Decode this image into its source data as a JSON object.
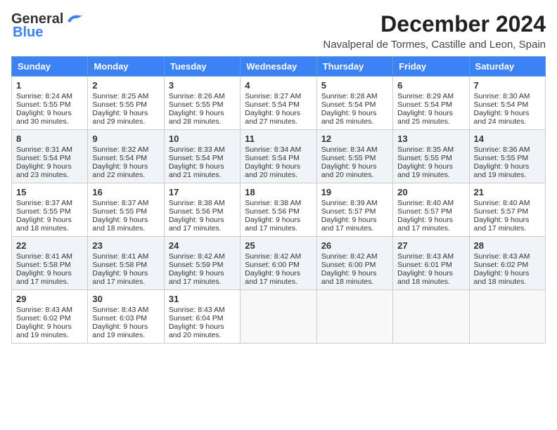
{
  "header": {
    "logo_line1": "General",
    "logo_line2": "Blue",
    "title": "December 2024",
    "subtitle": "Navalperal de Tormes, Castille and Leon, Spain"
  },
  "days_of_week": [
    "Sunday",
    "Monday",
    "Tuesday",
    "Wednesday",
    "Thursday",
    "Friday",
    "Saturday"
  ],
  "weeks": [
    [
      {
        "day": 1,
        "sunrise": "8:24 AM",
        "sunset": "5:55 PM",
        "daylight": "9 hours and 30 minutes."
      },
      {
        "day": 2,
        "sunrise": "8:25 AM",
        "sunset": "5:55 PM",
        "daylight": "9 hours and 29 minutes."
      },
      {
        "day": 3,
        "sunrise": "8:26 AM",
        "sunset": "5:55 PM",
        "daylight": "9 hours and 28 minutes."
      },
      {
        "day": 4,
        "sunrise": "8:27 AM",
        "sunset": "5:54 PM",
        "daylight": "9 hours and 27 minutes."
      },
      {
        "day": 5,
        "sunrise": "8:28 AM",
        "sunset": "5:54 PM",
        "daylight": "9 hours and 26 minutes."
      },
      {
        "day": 6,
        "sunrise": "8:29 AM",
        "sunset": "5:54 PM",
        "daylight": "9 hours and 25 minutes."
      },
      {
        "day": 7,
        "sunrise": "8:30 AM",
        "sunset": "5:54 PM",
        "daylight": "9 hours and 24 minutes."
      }
    ],
    [
      {
        "day": 8,
        "sunrise": "8:31 AM",
        "sunset": "5:54 PM",
        "daylight": "9 hours and 23 minutes."
      },
      {
        "day": 9,
        "sunrise": "8:32 AM",
        "sunset": "5:54 PM",
        "daylight": "9 hours and 22 minutes."
      },
      {
        "day": 10,
        "sunrise": "8:33 AM",
        "sunset": "5:54 PM",
        "daylight": "9 hours and 21 minutes."
      },
      {
        "day": 11,
        "sunrise": "8:34 AM",
        "sunset": "5:54 PM",
        "daylight": "9 hours and 20 minutes."
      },
      {
        "day": 12,
        "sunrise": "8:34 AM",
        "sunset": "5:55 PM",
        "daylight": "9 hours and 20 minutes."
      },
      {
        "day": 13,
        "sunrise": "8:35 AM",
        "sunset": "5:55 PM",
        "daylight": "9 hours and 19 minutes."
      },
      {
        "day": 14,
        "sunrise": "8:36 AM",
        "sunset": "5:55 PM",
        "daylight": "9 hours and 19 minutes."
      }
    ],
    [
      {
        "day": 15,
        "sunrise": "8:37 AM",
        "sunset": "5:55 PM",
        "daylight": "9 hours and 18 minutes."
      },
      {
        "day": 16,
        "sunrise": "8:37 AM",
        "sunset": "5:55 PM",
        "daylight": "9 hours and 18 minutes."
      },
      {
        "day": 17,
        "sunrise": "8:38 AM",
        "sunset": "5:56 PM",
        "daylight": "9 hours and 17 minutes."
      },
      {
        "day": 18,
        "sunrise": "8:38 AM",
        "sunset": "5:56 PM",
        "daylight": "9 hours and 17 minutes."
      },
      {
        "day": 19,
        "sunrise": "8:39 AM",
        "sunset": "5:57 PM",
        "daylight": "9 hours and 17 minutes."
      },
      {
        "day": 20,
        "sunrise": "8:40 AM",
        "sunset": "5:57 PM",
        "daylight": "9 hours and 17 minutes."
      },
      {
        "day": 21,
        "sunrise": "8:40 AM",
        "sunset": "5:57 PM",
        "daylight": "9 hours and 17 minutes."
      }
    ],
    [
      {
        "day": 22,
        "sunrise": "8:41 AM",
        "sunset": "5:58 PM",
        "daylight": "9 hours and 17 minutes."
      },
      {
        "day": 23,
        "sunrise": "8:41 AM",
        "sunset": "5:58 PM",
        "daylight": "9 hours and 17 minutes."
      },
      {
        "day": 24,
        "sunrise": "8:42 AM",
        "sunset": "5:59 PM",
        "daylight": "9 hours and 17 minutes."
      },
      {
        "day": 25,
        "sunrise": "8:42 AM",
        "sunset": "6:00 PM",
        "daylight": "9 hours and 17 minutes."
      },
      {
        "day": 26,
        "sunrise": "8:42 AM",
        "sunset": "6:00 PM",
        "daylight": "9 hours and 18 minutes."
      },
      {
        "day": 27,
        "sunrise": "8:43 AM",
        "sunset": "6:01 PM",
        "daylight": "9 hours and 18 minutes."
      },
      {
        "day": 28,
        "sunrise": "8:43 AM",
        "sunset": "6:02 PM",
        "daylight": "9 hours and 18 minutes."
      }
    ],
    [
      {
        "day": 29,
        "sunrise": "8:43 AM",
        "sunset": "6:02 PM",
        "daylight": "9 hours and 19 minutes."
      },
      {
        "day": 30,
        "sunrise": "8:43 AM",
        "sunset": "6:03 PM",
        "daylight": "9 hours and 19 minutes."
      },
      {
        "day": 31,
        "sunrise": "8:43 AM",
        "sunset": "6:04 PM",
        "daylight": "9 hours and 20 minutes."
      },
      null,
      null,
      null,
      null
    ]
  ]
}
